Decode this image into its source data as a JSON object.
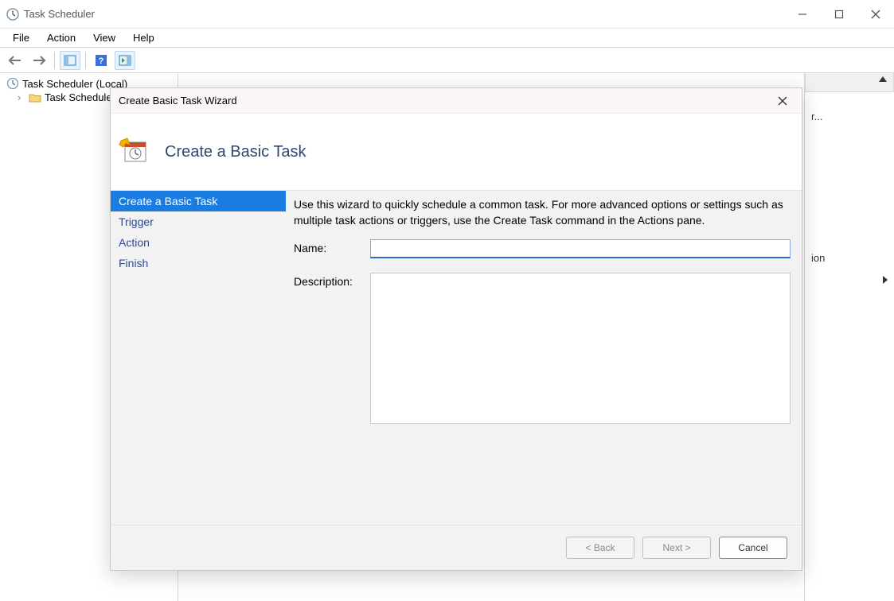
{
  "app": {
    "title": "Task Scheduler"
  },
  "menu": {
    "file": "File",
    "action": "Action",
    "view": "View",
    "help": "Help"
  },
  "tree": {
    "root": "Task Scheduler (Local)",
    "library": "Task Scheduler Library"
  },
  "actions_pane": {
    "item1": "r...",
    "item2": "ion"
  },
  "wizard": {
    "title": "Create Basic Task Wizard",
    "heading": "Create a Basic Task",
    "steps": {
      "create": "Create a Basic Task",
      "trigger": "Trigger",
      "action": "Action",
      "finish": "Finish"
    },
    "intro": "Use this wizard to quickly schedule a common task.  For more advanced options or settings such as multiple task actions or triggers, use the Create Task command in the Actions pane.",
    "labels": {
      "name": "Name:",
      "description": "Description:"
    },
    "values": {
      "name": "",
      "description": ""
    },
    "buttons": {
      "back": "< Back",
      "next": "Next >",
      "cancel": "Cancel"
    }
  }
}
